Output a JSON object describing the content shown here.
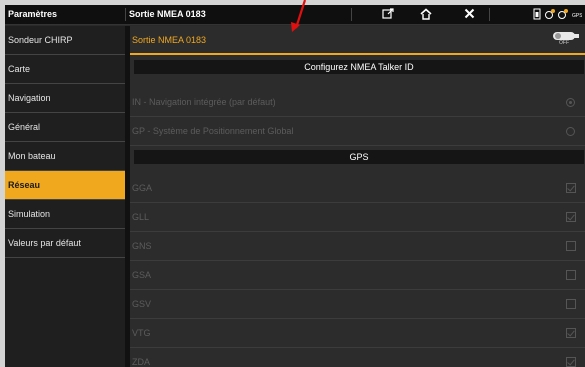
{
  "topbar": {
    "section_title": "Paramètres",
    "page_title": "Sortie NMEA  0183",
    "icons": [
      "export-icon",
      "home-icon",
      "close-icon",
      "status-icons"
    ]
  },
  "sidebar": {
    "items": [
      {
        "label": "Sondeur CHIRP",
        "active": false
      },
      {
        "label": "Carte",
        "active": false
      },
      {
        "label": "Navigation",
        "active": false
      },
      {
        "label": "Général",
        "active": false
      },
      {
        "label": "Mon bateau",
        "active": false
      },
      {
        "label": "Réseau",
        "active": true
      },
      {
        "label": "Simulation",
        "active": false
      },
      {
        "label": "Valeurs par défaut",
        "active": false
      }
    ]
  },
  "main": {
    "nmea_output": {
      "label": "Sortie NMEA  0183",
      "toggle_state": "OFF"
    },
    "talker_header": "Configurez NMEA Talker ID",
    "talker_options": [
      {
        "label": "IN - Navigation intégrée (par défaut)",
        "selected": true
      },
      {
        "label": "GP - Système de Positionnement Global",
        "selected": false
      }
    ],
    "gps_header": "GPS",
    "gps_sentences": [
      {
        "label": "GGA",
        "checked": true
      },
      {
        "label": "GLL",
        "checked": true
      },
      {
        "label": "GNS",
        "checked": false
      },
      {
        "label": "GSA",
        "checked": false
      },
      {
        "label": "GSV",
        "checked": false
      },
      {
        "label": "VTG",
        "checked": true
      },
      {
        "label": "ZDA",
        "checked": true
      }
    ]
  },
  "colors": {
    "accent": "#f0a81f",
    "annotation_arrow": "#e01010"
  }
}
